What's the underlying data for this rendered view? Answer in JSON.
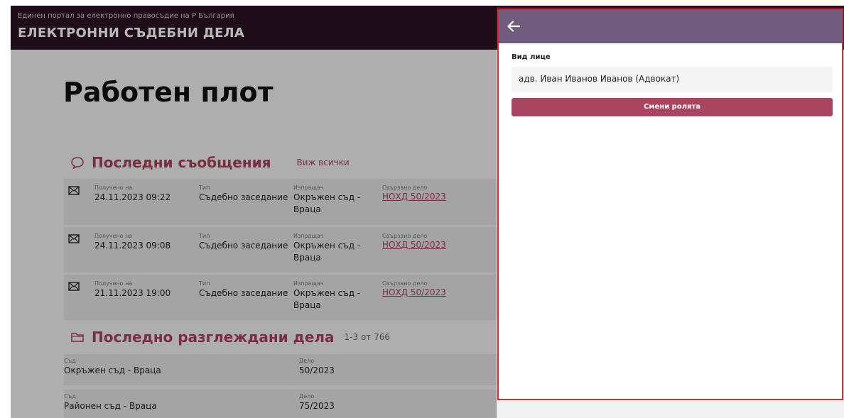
{
  "header": {
    "portal_text": "Единен портал за електронно правосъдие на Р България",
    "app_title": "ЕЛЕКТРОННИ СЪДЕБНИ ДЕЛА"
  },
  "page_title": "Работен плот",
  "messages": {
    "title": "Последни съобщения",
    "view_all": "Виж всички",
    "rows": [
      {
        "received_label": "Получено на",
        "received": "24.11.2023 09:22",
        "type_label": "Тип",
        "type": "Съдебно заседание",
        "sender_label": "Изпращач",
        "sender": "Окръжен съд - Враца",
        "case_label": "Свързано дело",
        "case": "НОХД 50/2023"
      },
      {
        "received_label": "Получено на",
        "received": "24.11.2023 09:08",
        "type_label": "Тип",
        "type": "Съдебно заседание",
        "sender_label": "Изпращач",
        "sender": "Окръжен съд - Враца",
        "case_label": "Свързано дело",
        "case": "НОХД 50/2023"
      },
      {
        "received_label": "Получено на",
        "received": "21.11.2023 19:00",
        "type_label": "Тип",
        "type": "Съдебно заседание",
        "sender_label": "Изпращач",
        "sender": "Окръжен съд - Враца",
        "case_label": "Свързано дело",
        "case": "НОХД 50/2023"
      }
    ]
  },
  "cases": {
    "title": "Последно разглеждани дела",
    "count": "1-3 от 766",
    "rows": [
      {
        "court_label": "Съд",
        "court": "Окръжен съд - Враца",
        "case_label": "Дело",
        "case": "50/2023"
      },
      {
        "court_label": "Съд",
        "court": "Районен съд - Враца",
        "case_label": "Дело",
        "case": "75/2023"
      }
    ]
  },
  "drawer": {
    "field_label": "Вид лице",
    "field_value": "адв. Иван Иванов Иванов (Адвокат)",
    "button_label": "Смени ролята"
  },
  "colors": {
    "header_bg": "#2d1224",
    "accent": "#a8415f",
    "drawer_header": "#725c7d",
    "drawer_border": "#e0262e",
    "button_bg": "#a94461"
  },
  "icons": {
    "back": "arrow-left-icon",
    "messages": "chat-bubble-icon",
    "mail": "envelope-icon",
    "cases": "folder-icon"
  }
}
